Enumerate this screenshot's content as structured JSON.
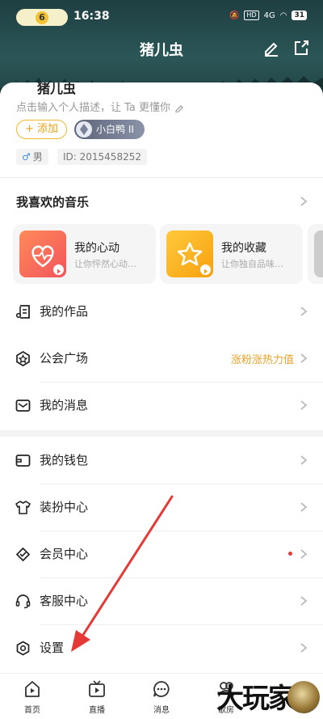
{
  "status_bar": {
    "pill_number": "6",
    "time": "16:38",
    "hd": "HD",
    "network": "4G",
    "battery": "31"
  },
  "nav": {
    "title": "猪儿虫",
    "icons": [
      "pencil-icon",
      "share-icon"
    ]
  },
  "profile": {
    "name_partial": "猪儿虫",
    "description": "点击输入个人描述，让 Ta 更懂你",
    "add_label": "+ 添加",
    "badge_label": "小白鸭 II",
    "gender_symbol": "♂",
    "gender_label": "男",
    "id_label": "ID: 2015458252"
  },
  "favorites": {
    "title": "我喜欢的音乐",
    "cards": [
      {
        "title": "我的心动",
        "subtitle": "让你怦然心动…",
        "color": "#f76a57"
      },
      {
        "title": "我的收藏",
        "subtitle": "让你独自品味…",
        "color": "#fbb21b"
      }
    ]
  },
  "menu_group_1": [
    {
      "label": "我的作品",
      "icon": "music-list-icon",
      "right_text": ""
    },
    {
      "label": "公会广场",
      "icon": "guild-star-icon",
      "right_text": "涨粉涨热力值"
    },
    {
      "label": "我的消息",
      "icon": "mail-icon",
      "right_text": ""
    }
  ],
  "menu_group_2": [
    {
      "label": "我的钱包",
      "icon": "wallet-icon"
    },
    {
      "label": "装扮中心",
      "icon": "tshirt-icon"
    },
    {
      "label": "会员中心",
      "icon": "vip-diamond-icon"
    },
    {
      "label": "客服中心",
      "icon": "headset-icon"
    },
    {
      "label": "设置",
      "icon": "settings-gear-icon"
    }
  ],
  "tabs": [
    {
      "label": "首页",
      "icon": "home-icon"
    },
    {
      "label": "直播",
      "icon": "live-tv-icon"
    },
    {
      "label": "消息",
      "icon": "chat-icon"
    },
    {
      "label": "歌房",
      "icon": "karaoke-icon"
    }
  ],
  "watermark": {
    "text": "大玩家"
  },
  "colors": {
    "accent": "#e8a22a",
    "annotation_arrow": "#e53935"
  }
}
